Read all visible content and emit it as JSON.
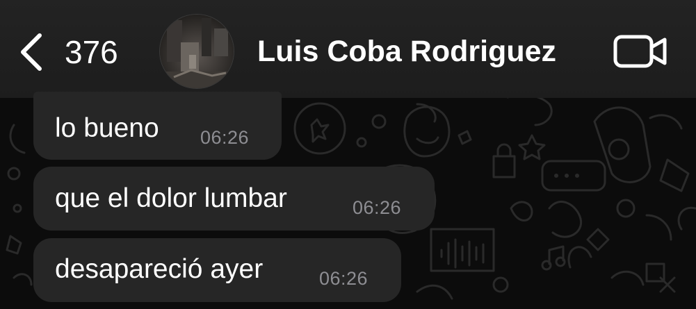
{
  "header": {
    "back_icon": "chevron-left-icon",
    "unread_count": "376",
    "contact_name": "Luis Coba Rodriguez",
    "video_icon": "video-camera-icon"
  },
  "messages": [
    {
      "text": "lo bueno",
      "time": "06:26"
    },
    {
      "text": "que el dolor lumbar",
      "time": "06:26"
    },
    {
      "text": "desapareció ayer",
      "time": "06:26"
    }
  ],
  "colors": {
    "header_bg": "#1f1f1f",
    "bubble_bg": "#262626",
    "text": "#ffffff",
    "timestamp": "#8e8e93",
    "wallpaper_bg": "#0c0c0c"
  }
}
